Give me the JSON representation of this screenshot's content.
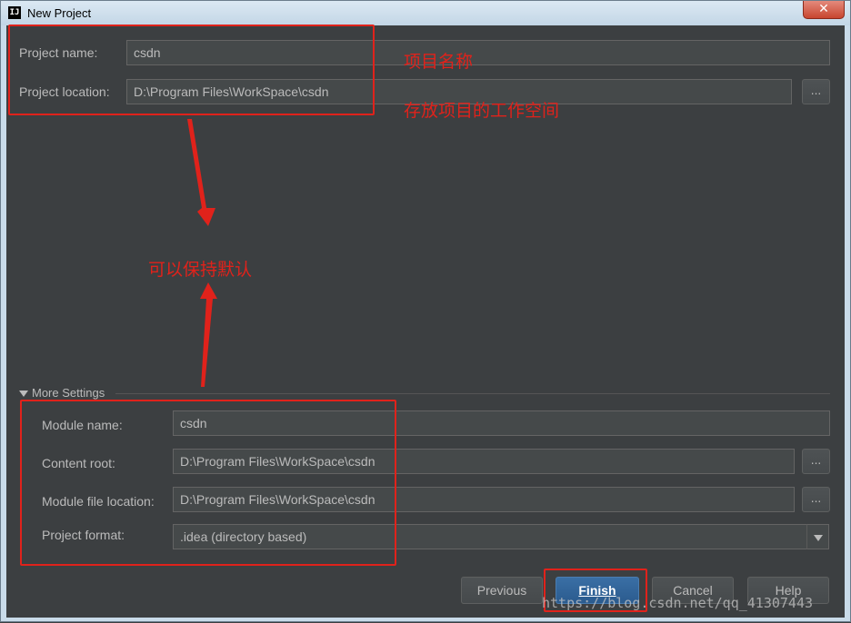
{
  "window": {
    "title": "New Project",
    "close_glyph": "✕",
    "app_icon": "IJ"
  },
  "project": {
    "name_label": "Project name:",
    "name_value": "csdn",
    "location_label": "Project location:",
    "location_value": "D:\\Program Files\\WorkSpace\\csdn",
    "browse_label": "..."
  },
  "more_settings": {
    "label": "More Settings",
    "module_name_label": "Module name:",
    "module_name_value": "csdn",
    "content_root_label": "Content root:",
    "content_root_value": "D:\\Program Files\\WorkSpace\\csdn",
    "module_file_label": "Module file location:",
    "module_file_value": "D:\\Program Files\\WorkSpace\\csdn",
    "format_label": "Project format:",
    "format_value": ".idea (directory based)",
    "browse_label": "..."
  },
  "buttons": {
    "previous": "Previous",
    "finish": "Finish",
    "cancel": "Cancel",
    "help": "Help"
  },
  "annotations": {
    "project_name_note": "项目名称",
    "location_note": "存放项目的工作空间",
    "default_note": "可以保持默认",
    "color": "#e0221b"
  },
  "watermark": "https://blog.csdn.net/qq_41307443",
  "icons": {
    "app": "intellij-icon",
    "close": "close-icon",
    "toggle": "triangle-down-icon",
    "dropdown": "chevron-down-icon"
  }
}
